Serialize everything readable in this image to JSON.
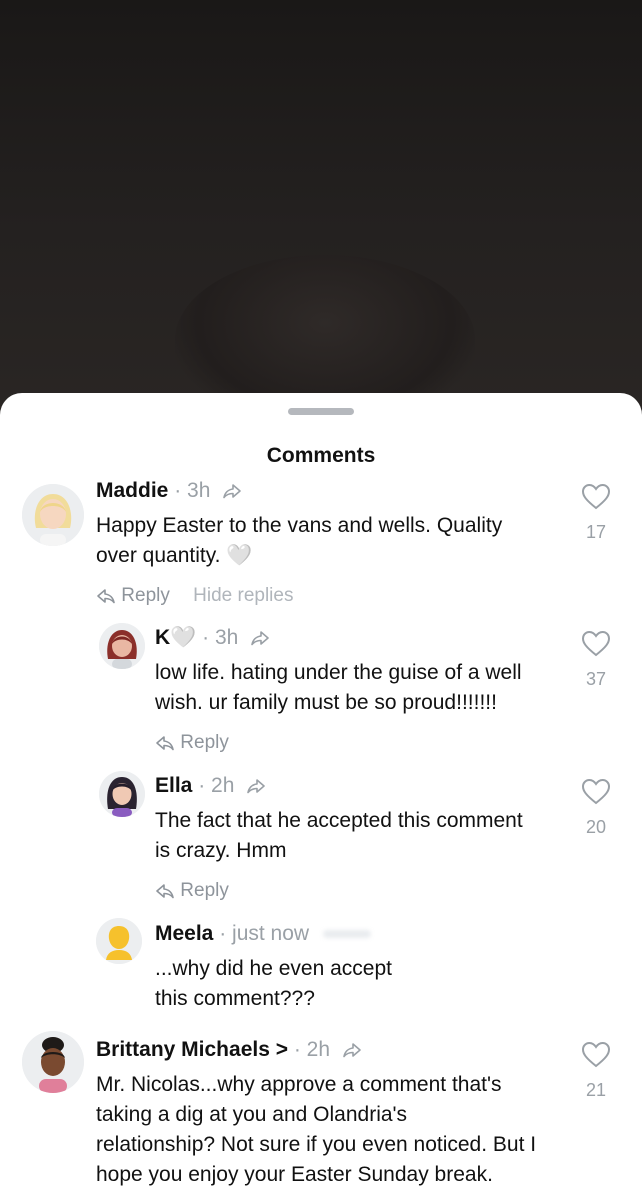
{
  "sheet": {
    "title": "Comments"
  },
  "comments": [
    {
      "name": "Maddie",
      "meta": "· 3h",
      "text_lines": [
        "Happy Easter to the vans and wells. Quality",
        "over quantity. 🤍"
      ],
      "likes": "17",
      "reply_label": "Reply",
      "hide_replies_label": "Hide replies"
    },
    {
      "name": "K🤍",
      "meta": "· 3h",
      "text_lines": [
        "low life. hating under the guise of a well",
        "wish. ur family must be so proud!!!!!!!"
      ],
      "likes": "37",
      "reply_label": "Reply"
    },
    {
      "name": "Ella",
      "meta": "· 2h",
      "text_lines": [
        "The fact that he accepted this comment",
        "is crazy. Hmm"
      ],
      "likes": "20",
      "reply_label": "Reply"
    },
    {
      "name": "Meela",
      "meta": "· just now",
      "text_lines": [
        "...why did he even accept",
        "this comment???"
      ]
    },
    {
      "name": "Brittany Michaels >",
      "meta": "· 2h",
      "text_lines": [
        "Mr. Nicolas...why approve a comment that's",
        "taking a dig at you and Olandria's",
        "relationship? Not sure if you even noticed. But I",
        "hope you enjoy your Easter Sunday break."
      ],
      "likes": "21"
    }
  ],
  "icons": {
    "heart": "heart-outline-icon",
    "share": "share-arrow-icon",
    "reply": "reply-arrow-icon"
  },
  "colors": {
    "meta": "#9aa0a6",
    "sheet": "#ffffff",
    "backdrop": "#1f1c1b"
  }
}
